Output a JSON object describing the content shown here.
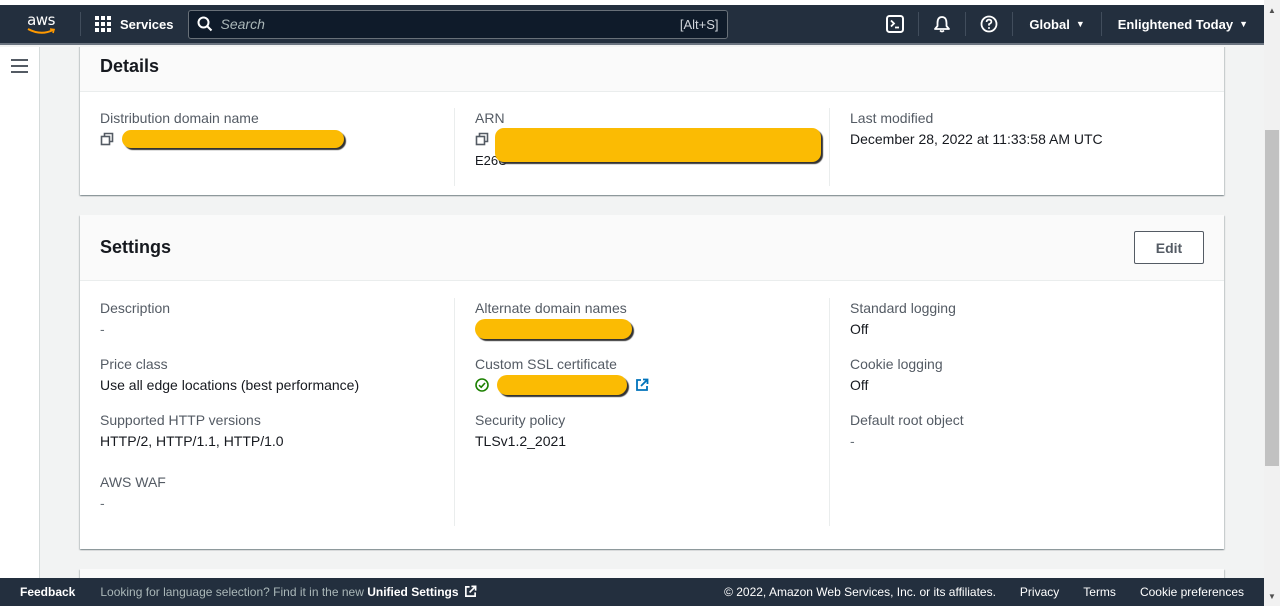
{
  "nav": {
    "logo": "aws",
    "services_label": "Services",
    "search_placeholder": "Search",
    "search_shortcut": "[Alt+S]",
    "region_label": "Global",
    "account_label": "Enlightened Today",
    "icons": [
      "cloudshell-icon",
      "bell-icon",
      "help-icon"
    ]
  },
  "details": {
    "title": "Details",
    "fields": {
      "distribution_domain_name": {
        "label": "Distribution domain name",
        "value": "[redacted]"
      },
      "arn": {
        "label": "ARN",
        "value_prefix": "E26U",
        "value": "[redacted]"
      },
      "last_modified": {
        "label": "Last modified",
        "value": "December 28, 2022 at 11:33:58 AM UTC"
      }
    }
  },
  "settings": {
    "title": "Settings",
    "edit_label": "Edit",
    "fields": {
      "description": {
        "label": "Description",
        "value": "-"
      },
      "price_class": {
        "label": "Price class",
        "value": "Use all edge locations (best performance)"
      },
      "http_versions": {
        "label": "Supported HTTP versions",
        "value": "HTTP/2, HTTP/1.1, HTTP/1.0"
      },
      "aws_waf": {
        "label": "AWS WAF",
        "value": "-"
      },
      "alternate_domain_names": {
        "label": "Alternate domain names",
        "value": "[redacted]"
      },
      "custom_ssl_certificate": {
        "label": "Custom SSL certificate",
        "value": "[redacted]",
        "status": "valid"
      },
      "security_policy": {
        "label": "Security policy",
        "value": "TLSv1.2_2021"
      },
      "standard_logging": {
        "label": "Standard logging",
        "value": "Off"
      },
      "cookie_logging": {
        "label": "Cookie logging",
        "value": "Off"
      },
      "default_root_object": {
        "label": "Default root object",
        "value": "-"
      }
    }
  },
  "footer": {
    "feedback": "Feedback",
    "language_text": "Looking for language selection? Find it in the new",
    "unified_settings": "Unified Settings",
    "copyright": "© 2022, Amazon Web Services, Inc. or its affiliates.",
    "privacy": "Privacy",
    "terms": "Terms",
    "cookie_preferences": "Cookie preferences"
  },
  "colors": {
    "nav_bg": "#232f3e",
    "redaction": "#fbbb03",
    "success": "#1d8102",
    "link": "#0073bb"
  }
}
